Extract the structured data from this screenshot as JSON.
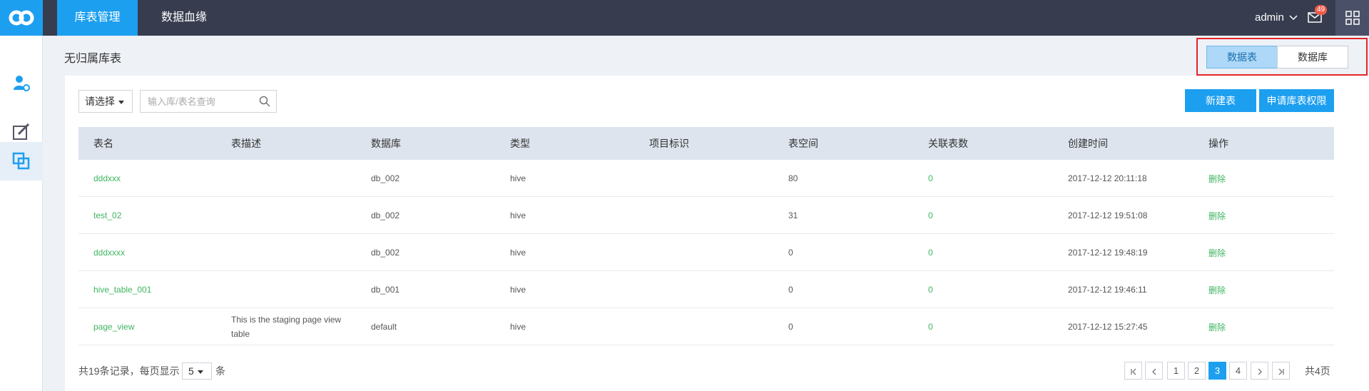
{
  "nav": {
    "tabs": [
      {
        "label": "库表管理",
        "active": true
      },
      {
        "label": "数据血缘",
        "active": false
      }
    ],
    "user": "admin",
    "mail_count": "49",
    "accent_color": "#1d9ff0"
  },
  "sidebar": {
    "items": [
      {
        "icon": "user-settings-icon"
      },
      {
        "icon": "edit-icon"
      },
      {
        "icon": "copy-icon",
        "active": true
      }
    ]
  },
  "page": {
    "title": "无归属库表",
    "toggle": {
      "table_label": "数据表",
      "db_label": "数据库",
      "active": "数据表"
    }
  },
  "toolbar": {
    "select_label": "请选择",
    "search_placeholder": "输入库/表名查询",
    "new_table_label": "新建表",
    "apply_perm_label": "申请库表权限"
  },
  "table": {
    "columns": [
      "表名",
      "表描述",
      "数据库",
      "类型",
      "项目标识",
      "表空间",
      "关联表数",
      "创建时间",
      "操作"
    ],
    "rows": [
      {
        "name": "dddxxx",
        "desc": "",
        "db": "db_002",
        "type": "hive",
        "project": "",
        "space": "80",
        "links": "0",
        "created": "2017-12-12 20:11:18",
        "action": "删除"
      },
      {
        "name": "test_02",
        "desc": "",
        "db": "db_002",
        "type": "hive",
        "project": "",
        "space": "31",
        "links": "0",
        "created": "2017-12-12 19:51:08",
        "action": "删除"
      },
      {
        "name": "dddxxxx",
        "desc": "",
        "db": "db_002",
        "type": "hive",
        "project": "",
        "space": "0",
        "links": "0",
        "created": "2017-12-12 19:48:19",
        "action": "删除"
      },
      {
        "name": "hive_table_001",
        "desc": "",
        "db": "db_001",
        "type": "hive",
        "project": "",
        "space": "0",
        "links": "0",
        "created": "2017-12-12 19:46:11",
        "action": "删除"
      },
      {
        "name": "page_view",
        "desc": "This is the staging page view table",
        "db": "default",
        "type": "hive",
        "project": "",
        "space": "0",
        "links": "0",
        "created": "2017-12-12 15:27:45",
        "action": "删除"
      }
    ]
  },
  "footer": {
    "total_prefix": "共19条记录，每页显示",
    "page_size": "5",
    "unit": "条",
    "pages": [
      "1",
      "2",
      "3",
      "4"
    ],
    "current_page": "3",
    "total_pages_label": "共4页"
  }
}
